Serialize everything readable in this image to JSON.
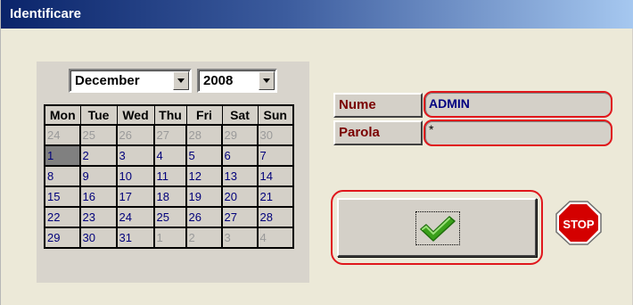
{
  "window": {
    "title": "Identificare"
  },
  "calendar": {
    "month": "December",
    "year": "2008",
    "weekdays": [
      "Mon",
      "Tue",
      "Wed",
      "Thu",
      "Fri",
      "Sat",
      "Sun"
    ],
    "weeks": [
      [
        "24",
        "25",
        "26",
        "27",
        "28",
        "29",
        "30"
      ],
      [
        "1",
        "2",
        "3",
        "4",
        "5",
        "6",
        "7"
      ],
      [
        "8",
        "9",
        "10",
        "11",
        "12",
        "13",
        "14"
      ],
      [
        "15",
        "16",
        "17",
        "18",
        "19",
        "20",
        "21"
      ],
      [
        "22",
        "23",
        "24",
        "25",
        "26",
        "27",
        "28"
      ],
      [
        "29",
        "30",
        "31",
        "1",
        "2",
        "3",
        "4"
      ]
    ],
    "selected_day": "1"
  },
  "login": {
    "user_label": "Nume",
    "user_value": "ADMIN",
    "password_label": "Parola",
    "password_value": "*"
  },
  "buttons": {
    "ok_icon": "checkmark-icon",
    "stop_icon": "stop-sign-icon",
    "stop_text": "STOP"
  },
  "colors": {
    "title_gradient_start": "#0a246a",
    "highlight_border": "#e0171c",
    "label_text": "#7a0000",
    "field_text": "#000080",
    "checkmark": "#3aa01a",
    "stop_red": "#d40000"
  }
}
